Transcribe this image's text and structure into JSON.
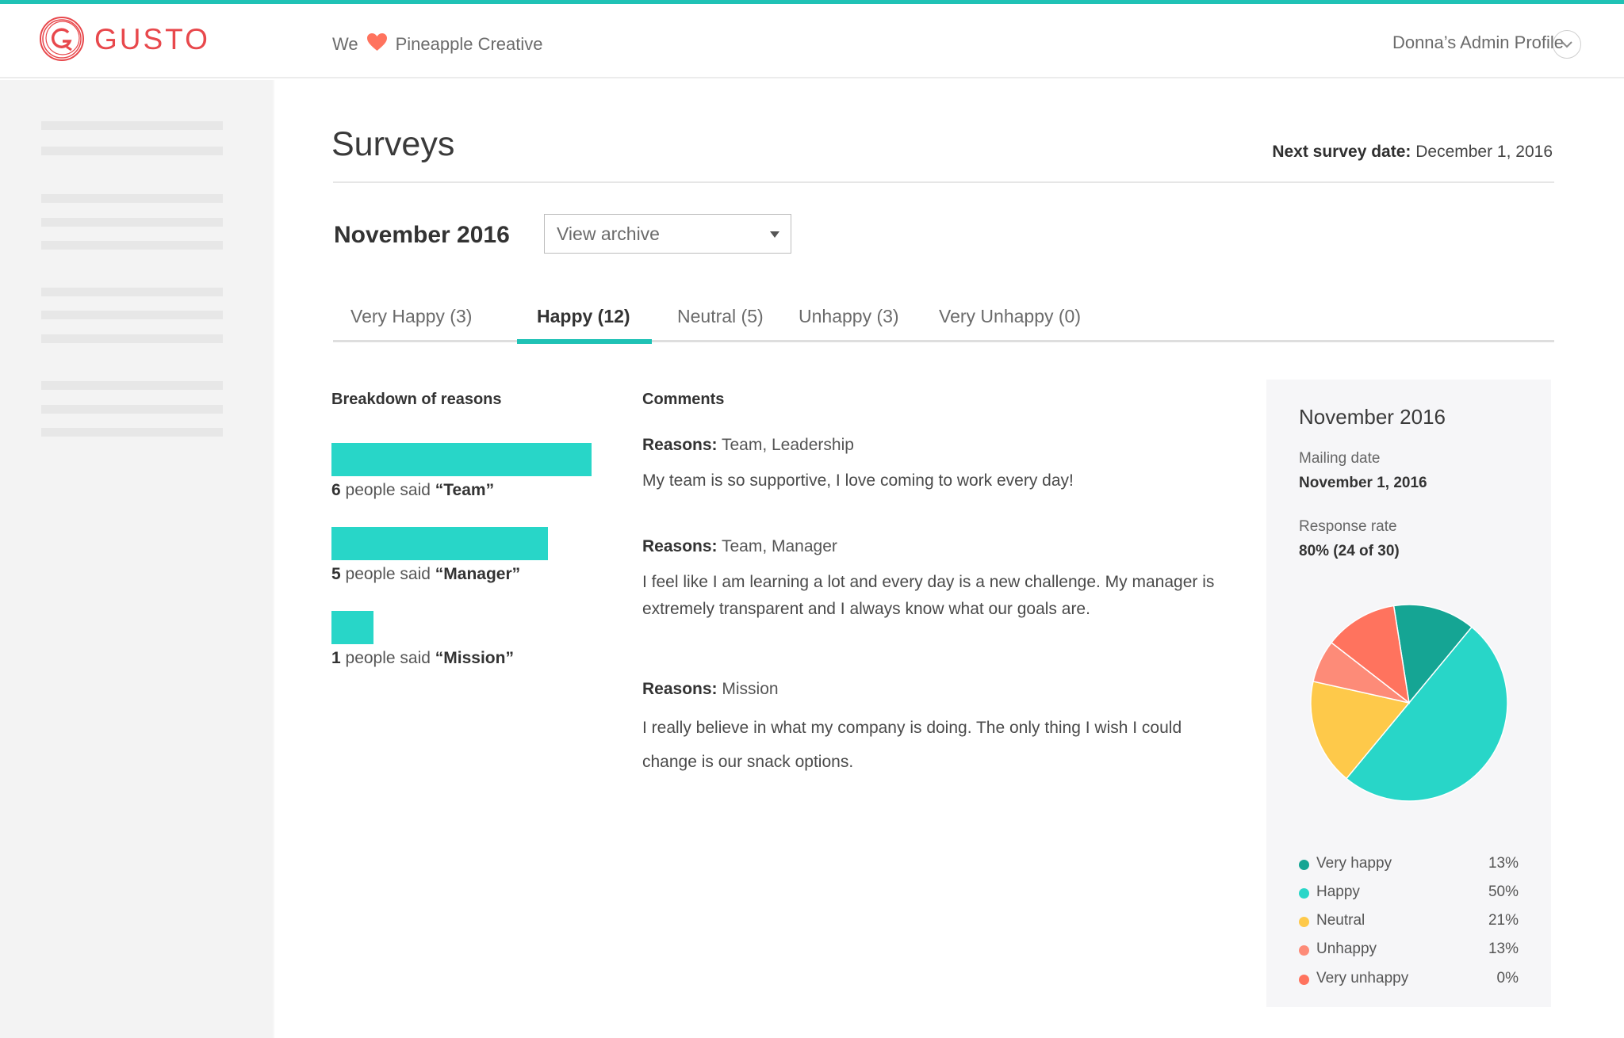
{
  "app": {
    "brand": "GUSTO",
    "accent_color": "#1fc2b5",
    "brand_color": "#e8484c"
  },
  "header": {
    "we_label": "We",
    "heart_icon": "heart-icon",
    "company": "Pineapple Creative",
    "profile_label": "Donna’s Admin Profile",
    "profile_icon": "chevron-down-icon"
  },
  "page": {
    "title": "Surveys",
    "next_survey_label": "Next survey date:",
    "next_survey_value": " December 1, 2016",
    "period": "November 2016",
    "archive_select": {
      "selected": "View archive"
    }
  },
  "tabs": [
    {
      "label": "Very Happy (3)",
      "active": false
    },
    {
      "label": "Happy (12)",
      "active": true
    },
    {
      "label": "Neutral (5)",
      "active": false
    },
    {
      "label": "Unhappy (3)",
      "active": false
    },
    {
      "label": "Very Unhappy (0)",
      "active": false
    }
  ],
  "breakdown": {
    "heading": "Breakdown of reasons",
    "middle_text": " people said ",
    "items": [
      {
        "count": "6",
        "reason": "“Team”",
        "value": 6
      },
      {
        "count": "5",
        "reason": "“Manager”",
        "value": 5
      },
      {
        "count": "1",
        "reason": "“Mission”",
        "value": 1
      }
    ]
  },
  "comments": {
    "heading": "Comments",
    "reasons_label": "Reasons:",
    "items": [
      {
        "reasons": " Team, Leadership",
        "text": "My team is so supportive, I love coming to work every day!"
      },
      {
        "reasons": " Team,  Manager",
        "text": "I feel like I am learning a lot and every day is a new challenge. My manager is extremely transparent and I always know what our goals are."
      },
      {
        "reasons": " Mission",
        "text": "I really believe in what my company is doing. The only thing I wish I could change is our snack options."
      }
    ]
  },
  "summary": {
    "title": "November 2016",
    "mailing_label": "Mailing date",
    "mailing_value": "November 1, 2016",
    "response_label": "Response rate",
    "response_value": "80% (24 of 30)"
  },
  "chart_data": {
    "type": "pie",
    "title": "November 2016",
    "legend_position": "bottom",
    "categories": [
      "Very happy",
      "Happy",
      "Neutral",
      "Unhappy",
      "Very unhappy"
    ],
    "values": [
      13,
      50,
      21,
      13,
      0
    ],
    "value_labels": [
      "13%",
      "50%",
      "21%",
      "13%",
      "0%"
    ],
    "drawn_slice_shares": [
      13.5,
      50,
      17.5,
      7,
      12
    ],
    "colors": [
      "#15a594",
      "#28d6c8",
      "#fec94a",
      "#fd8b78",
      "#ff735e"
    ]
  }
}
